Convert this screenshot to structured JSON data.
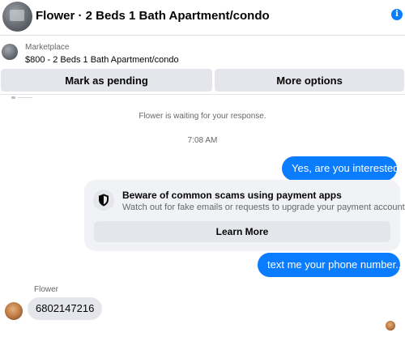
{
  "header": {
    "title": "Flower · 2 Beds 1 Bath Apartment/condo",
    "info_icon": "info-icon",
    "accent_color": "#0a7cff"
  },
  "listing": {
    "label": "Marketplace",
    "price_title": "$800 - 2 Beds 1 Bath Apartment/condo"
  },
  "actions": {
    "pending_label": "Mark as pending",
    "more_label": "More options"
  },
  "conversation": {
    "waiting_text": "Flower is waiting for your response.",
    "timestamp": "7:08 AM",
    "messages": [
      {
        "from": "me",
        "text": "Yes, are you interested?"
      },
      {
        "from": "me",
        "text": "text me your phone number..."
      },
      {
        "from": "Flower",
        "text": "6802147216"
      }
    ],
    "sender_name": "Flower"
  },
  "warning": {
    "icon": "shield-icon",
    "title": "Beware of common scams using payment apps",
    "description": "Watch out for fake emails or requests to upgrade your payment account.",
    "button_label": "Learn More"
  }
}
